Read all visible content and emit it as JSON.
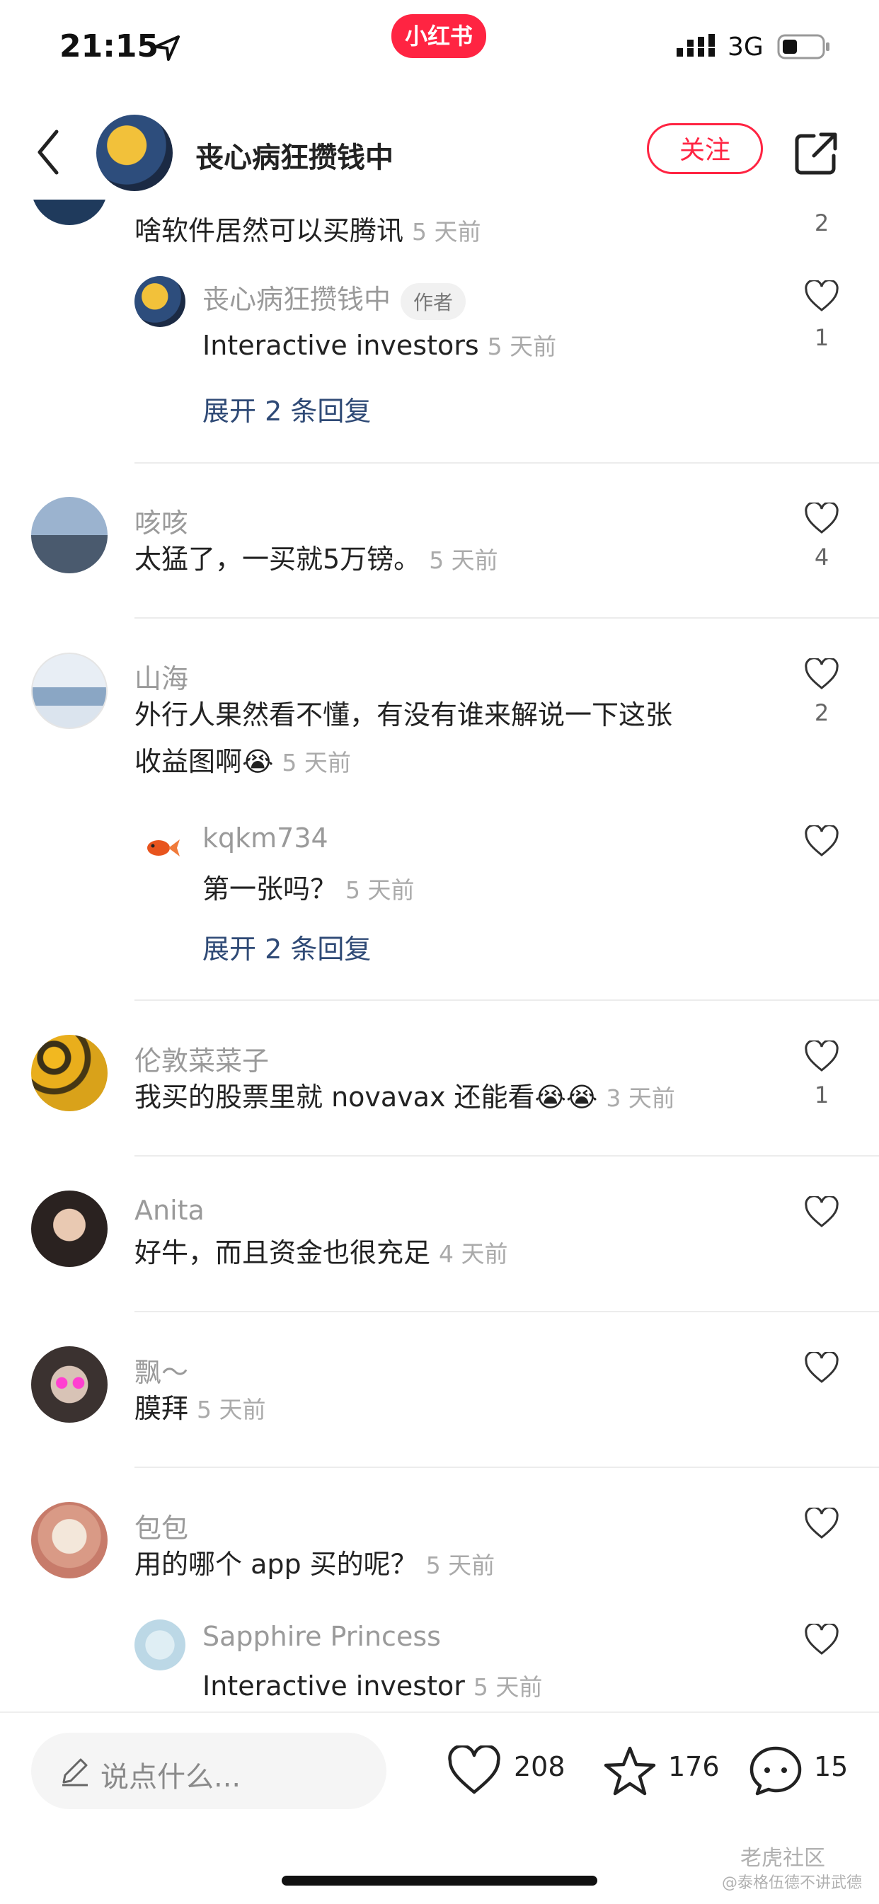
{
  "status_bar": {
    "time": "21:15",
    "brand": "小红书",
    "network": "3G"
  },
  "header": {
    "title": "丧心病狂攒钱中",
    "follow_label": "关注"
  },
  "comments": [
    {
      "text": "啥软件居然可以买腾讯",
      "time": "5 天前",
      "likes": "2"
    },
    {
      "reply_name": "丧心病狂攒钱中",
      "author_tag": "作者",
      "text": "Interactive investors",
      "time": "5 天前",
      "likes": "1",
      "expand": "展开 2 条回复"
    },
    {
      "name": "咳咳",
      "text": "太猛了，一买就5万镑。",
      "time": "5 天前",
      "likes": "4"
    },
    {
      "name": "山海",
      "text_line1": "外行人果然看不懂，有没有谁来解说一下这张",
      "text_line2": "收益图啊",
      "emoji": "😭",
      "time": "5 天前",
      "likes": "2"
    },
    {
      "reply_name": "kqkm734",
      "text": "第一张吗？",
      "time": "5 天前",
      "expand": "展开 2 条回复"
    },
    {
      "name": "伦敦菜菜子",
      "text": "我买的股票里就 novavax 还能看",
      "emoji": "😭😭",
      "time": "3 天前",
      "likes": "1"
    },
    {
      "name": "Anita",
      "text": "好牛，而且资金也很充足",
      "time": "4 天前"
    },
    {
      "name": "飘～",
      "text": "膜拜",
      "time": "5 天前"
    },
    {
      "name": "包包",
      "text": "用的哪个 app 买的呢？",
      "time": "5 天前"
    },
    {
      "reply_name": "Sapphire Princess",
      "text": "Interactive investor",
      "time": "5 天前"
    }
  ],
  "bottom_bar": {
    "placeholder": "说点什么...",
    "likes": "208",
    "stars": "176",
    "comments": "15",
    "watermark": "老虎社区",
    "watermark_sub": "@泰格伍德不讲武德"
  },
  "colors": {
    "accent": "#ff2442",
    "link": "#2f4a76"
  }
}
